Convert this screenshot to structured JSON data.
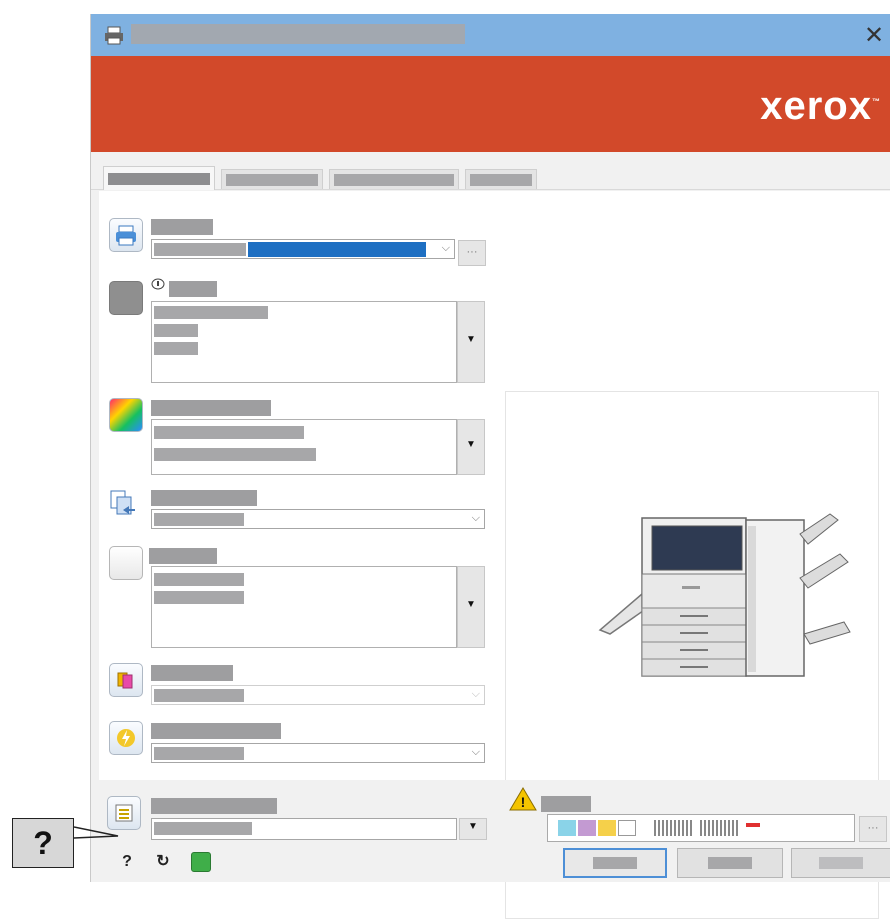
{
  "window": {
    "brand": "xerox",
    "brand_mark": "™",
    "close_glyph": "✕"
  },
  "footer": {
    "help_glyph": "?",
    "reset_glyph": "↻",
    "warning_glyph": "!",
    "more_glyph": "···"
  },
  "callout": {
    "text": "?"
  },
  "colors": {
    "titlebar": "#7fb1e1",
    "banner": "#d2492a",
    "selected_printer": "#1e6fc2",
    "primary_button_border": "#4d8fd6",
    "redaction": "#a7a7a9"
  },
  "icons": [
    "printer-icon",
    "close-icon",
    "paper-icon",
    "color-icon",
    "copies-icon",
    "finishing-icon",
    "stapling-icon",
    "eco-icon",
    "presets-icon",
    "warning-icon",
    "help-icon",
    "reset-icon",
    "status-icon",
    "printer-image"
  ]
}
